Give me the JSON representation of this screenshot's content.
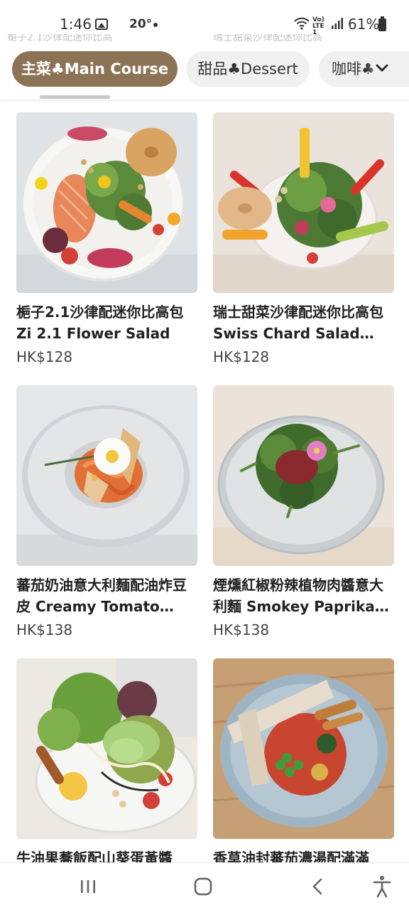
{
  "status_bar": {
    "time": "1:46",
    "temperature": "20°",
    "network": "Vo) LTE1",
    "battery": "61%"
  },
  "peek_texts": [
    "梔子2.1沙律配迷你比高",
    "瑞士甜菜沙律配迷你比高"
  ],
  "categories": {
    "main": "主菜♣Main Course",
    "dessert": "甜品♣Dessert",
    "coffee": "咖啡♣"
  },
  "items": [
    {
      "name": "梔子2.1沙律配迷你比高包 Zi 2.1 Flower Salad",
      "price": "HK$128"
    },
    {
      "name": "瑞士甜菜沙律配迷你比高包 Swiss Chard Salad with Mini Bagel",
      "price": "HK$128"
    },
    {
      "name": "蕃茄奶油意大利麵配油炸豆皮 Creamy Tomato Pasta with Fried Beancurd Skin",
      "price": "HK$138"
    },
    {
      "name": "煙燻紅椒粉辣植物肉醬意大利麵 Smokey Paprika Spicy Plant-based Meat Pasta",
      "price": "HK$138"
    },
    {
      "name": "牛油果蕎飯配山葵蛋黃醬",
      "price": ""
    },
    {
      "name": "香草油封蕃茄濃湯配滿滿",
      "price": ""
    }
  ],
  "colors": {
    "active_chip": "#8c7355",
    "inactive_chip": "#f0f0f0"
  }
}
